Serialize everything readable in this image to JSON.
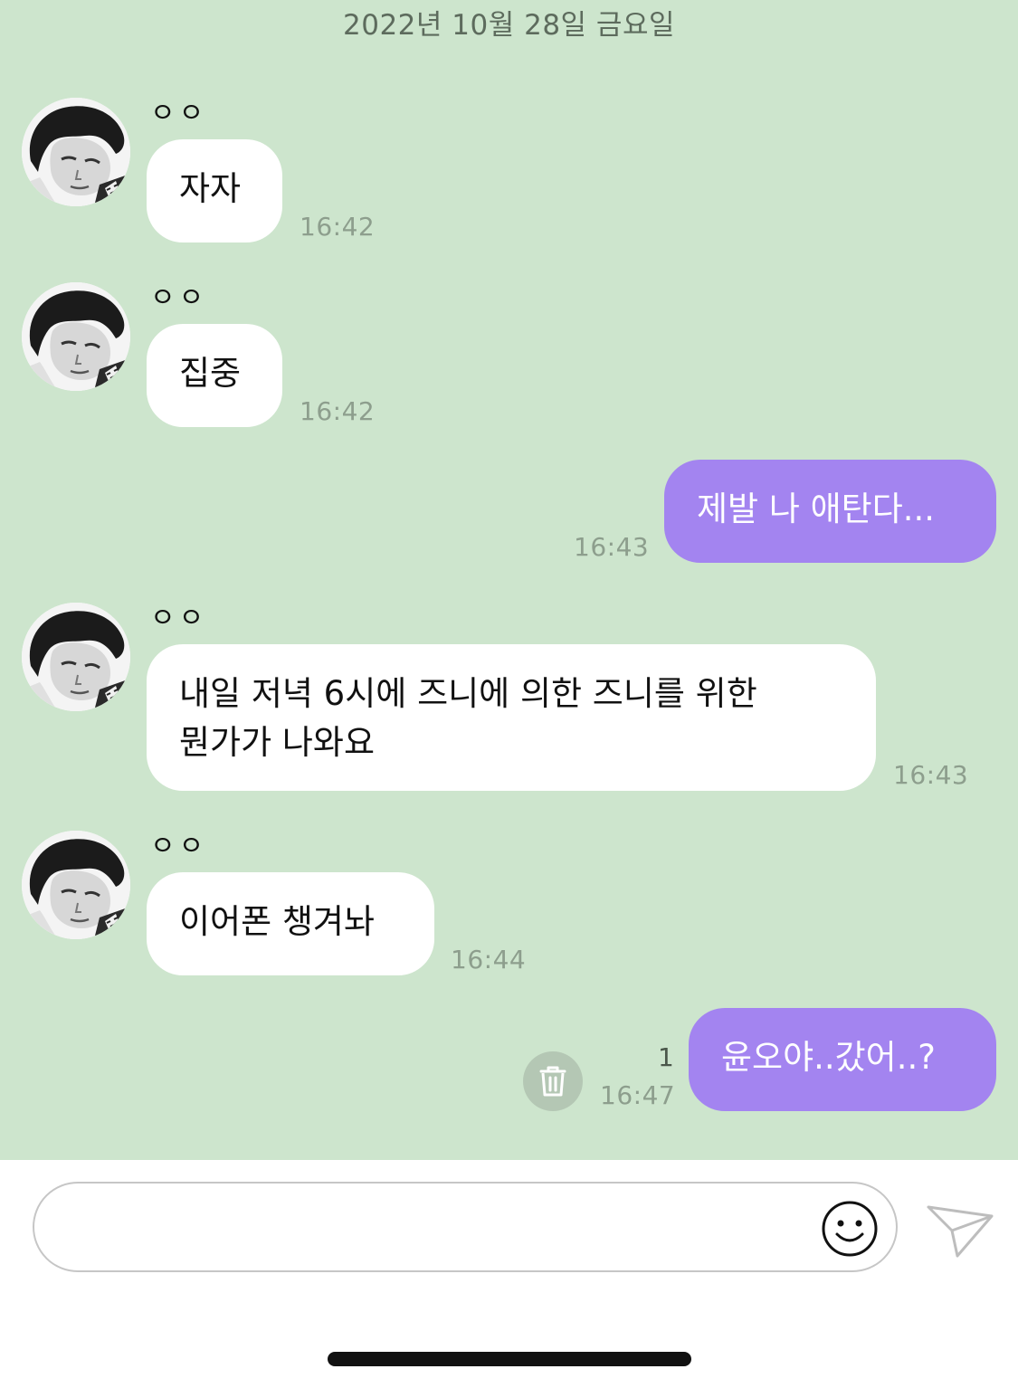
{
  "date_divider": "2022년 10월 28일 금요일",
  "messages": [
    {
      "sender": "ㅇㅇ",
      "text": "자자",
      "time": "16:42"
    },
    {
      "sender": "ㅇㅇ",
      "text": "집중",
      "time": "16:42"
    },
    {
      "text": "제발 나 애탄다...",
      "time": "16:43"
    },
    {
      "sender": "ㅇㅇ",
      "text": "내일 저녁 6시에 즈니에 의한 즈니를 위한\n뭔가가 나와요",
      "time": "16:43"
    },
    {
      "sender": "ㅇㅇ",
      "text": "이어폰 챙겨놔",
      "time": "16:44"
    },
    {
      "text": "윤오야..갔어..?",
      "time": "16:47",
      "unread_count": "1"
    }
  ],
  "icons": {
    "avatar": "profile-photo",
    "trash": "trash-icon",
    "emoji": "smiley-icon",
    "send": "paper-plane-icon"
  },
  "colors": {
    "chat_background": "#cde5cd",
    "received_bubble": "#ffffff",
    "sent_bubble": "#a384f0",
    "timestamp": "#8d9e8d"
  },
  "input": {
    "value": "",
    "placeholder": ""
  }
}
